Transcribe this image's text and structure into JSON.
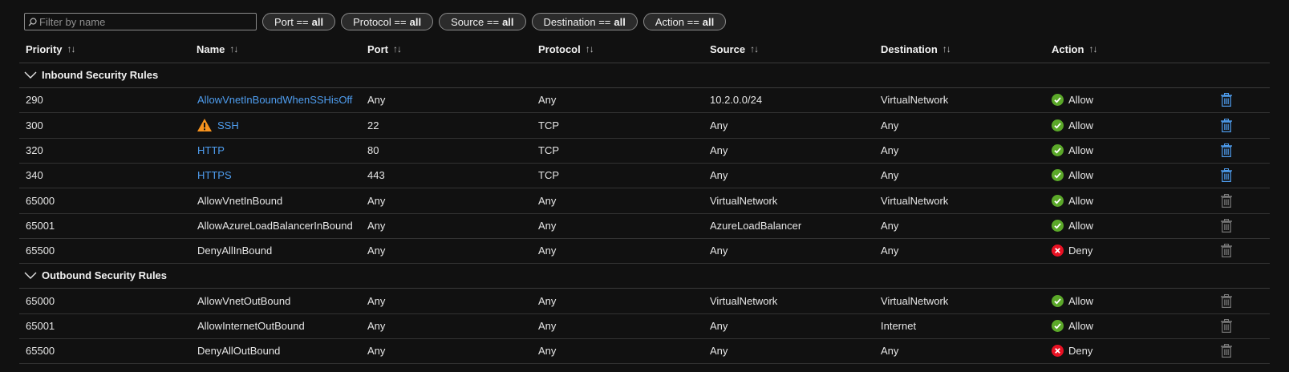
{
  "filter": {
    "placeholder": "Filter by name",
    "pills": [
      {
        "label": "Port == ",
        "value": "all"
      },
      {
        "label": "Protocol == ",
        "value": "all"
      },
      {
        "label": "Source == ",
        "value": "all"
      },
      {
        "label": "Destination == ",
        "value": "all"
      },
      {
        "label": "Action == ",
        "value": "all"
      }
    ]
  },
  "columns": [
    "Priority",
    "Name",
    "Port",
    "Protocol",
    "Source",
    "Destination",
    "Action"
  ],
  "sort_glyph": "↑↓",
  "groups": [
    {
      "title": "Inbound Security Rules",
      "rows": [
        {
          "priority": "290",
          "name": "AllowVnetInBoundWhenSSHisOff",
          "port": "Any",
          "protocol": "Any",
          "source": "10.2.0.0/24",
          "destination": "VirtualNetwork",
          "action": "Allow",
          "custom": true,
          "warning": false
        },
        {
          "priority": "300",
          "name": "SSH",
          "port": "22",
          "protocol": "TCP",
          "source": "Any",
          "destination": "Any",
          "action": "Allow",
          "custom": true,
          "warning": true
        },
        {
          "priority": "320",
          "name": "HTTP",
          "port": "80",
          "protocol": "TCP",
          "source": "Any",
          "destination": "Any",
          "action": "Allow",
          "custom": true,
          "warning": false
        },
        {
          "priority": "340",
          "name": "HTTPS",
          "port": "443",
          "protocol": "TCP",
          "source": "Any",
          "destination": "Any",
          "action": "Allow",
          "custom": true,
          "warning": false
        },
        {
          "priority": "65000",
          "name": "AllowVnetInBound",
          "port": "Any",
          "protocol": "Any",
          "source": "VirtualNetwork",
          "destination": "VirtualNetwork",
          "action": "Allow",
          "custom": false,
          "warning": false
        },
        {
          "priority": "65001",
          "name": "AllowAzureLoadBalancerInBound",
          "port": "Any",
          "protocol": "Any",
          "source": "AzureLoadBalancer",
          "destination": "Any",
          "action": "Allow",
          "custom": false,
          "warning": false
        },
        {
          "priority": "65500",
          "name": "DenyAllInBound",
          "port": "Any",
          "protocol": "Any",
          "source": "Any",
          "destination": "Any",
          "action": "Deny",
          "custom": false,
          "warning": false
        }
      ]
    },
    {
      "title": "Outbound Security Rules",
      "rows": [
        {
          "priority": "65000",
          "name": "AllowVnetOutBound",
          "port": "Any",
          "protocol": "Any",
          "source": "VirtualNetwork",
          "destination": "VirtualNetwork",
          "action": "Allow",
          "custom": false,
          "warning": false
        },
        {
          "priority": "65001",
          "name": "AllowInternetOutBound",
          "port": "Any",
          "protocol": "Any",
          "source": "Any",
          "destination": "Internet",
          "action": "Allow",
          "custom": false,
          "warning": false
        },
        {
          "priority": "65500",
          "name": "DenyAllOutBound",
          "port": "Any",
          "protocol": "Any",
          "source": "Any",
          "destination": "Any",
          "action": "Deny",
          "custom": false,
          "warning": false
        }
      ]
    }
  ],
  "icons": {
    "search": "search-icon",
    "chevron": "chevron-down-icon",
    "allow": "check-circle-icon",
    "deny": "x-circle-icon",
    "warning": "warning-icon",
    "delete": "trash-icon"
  },
  "colors": {
    "background": "#111111",
    "link": "#4f9ef0",
    "allow": "#5ba829",
    "deny": "#e81123",
    "warning": "#f7931e",
    "trash_active": "#4f9ef0",
    "trash_disabled": "#7a7a7a"
  }
}
